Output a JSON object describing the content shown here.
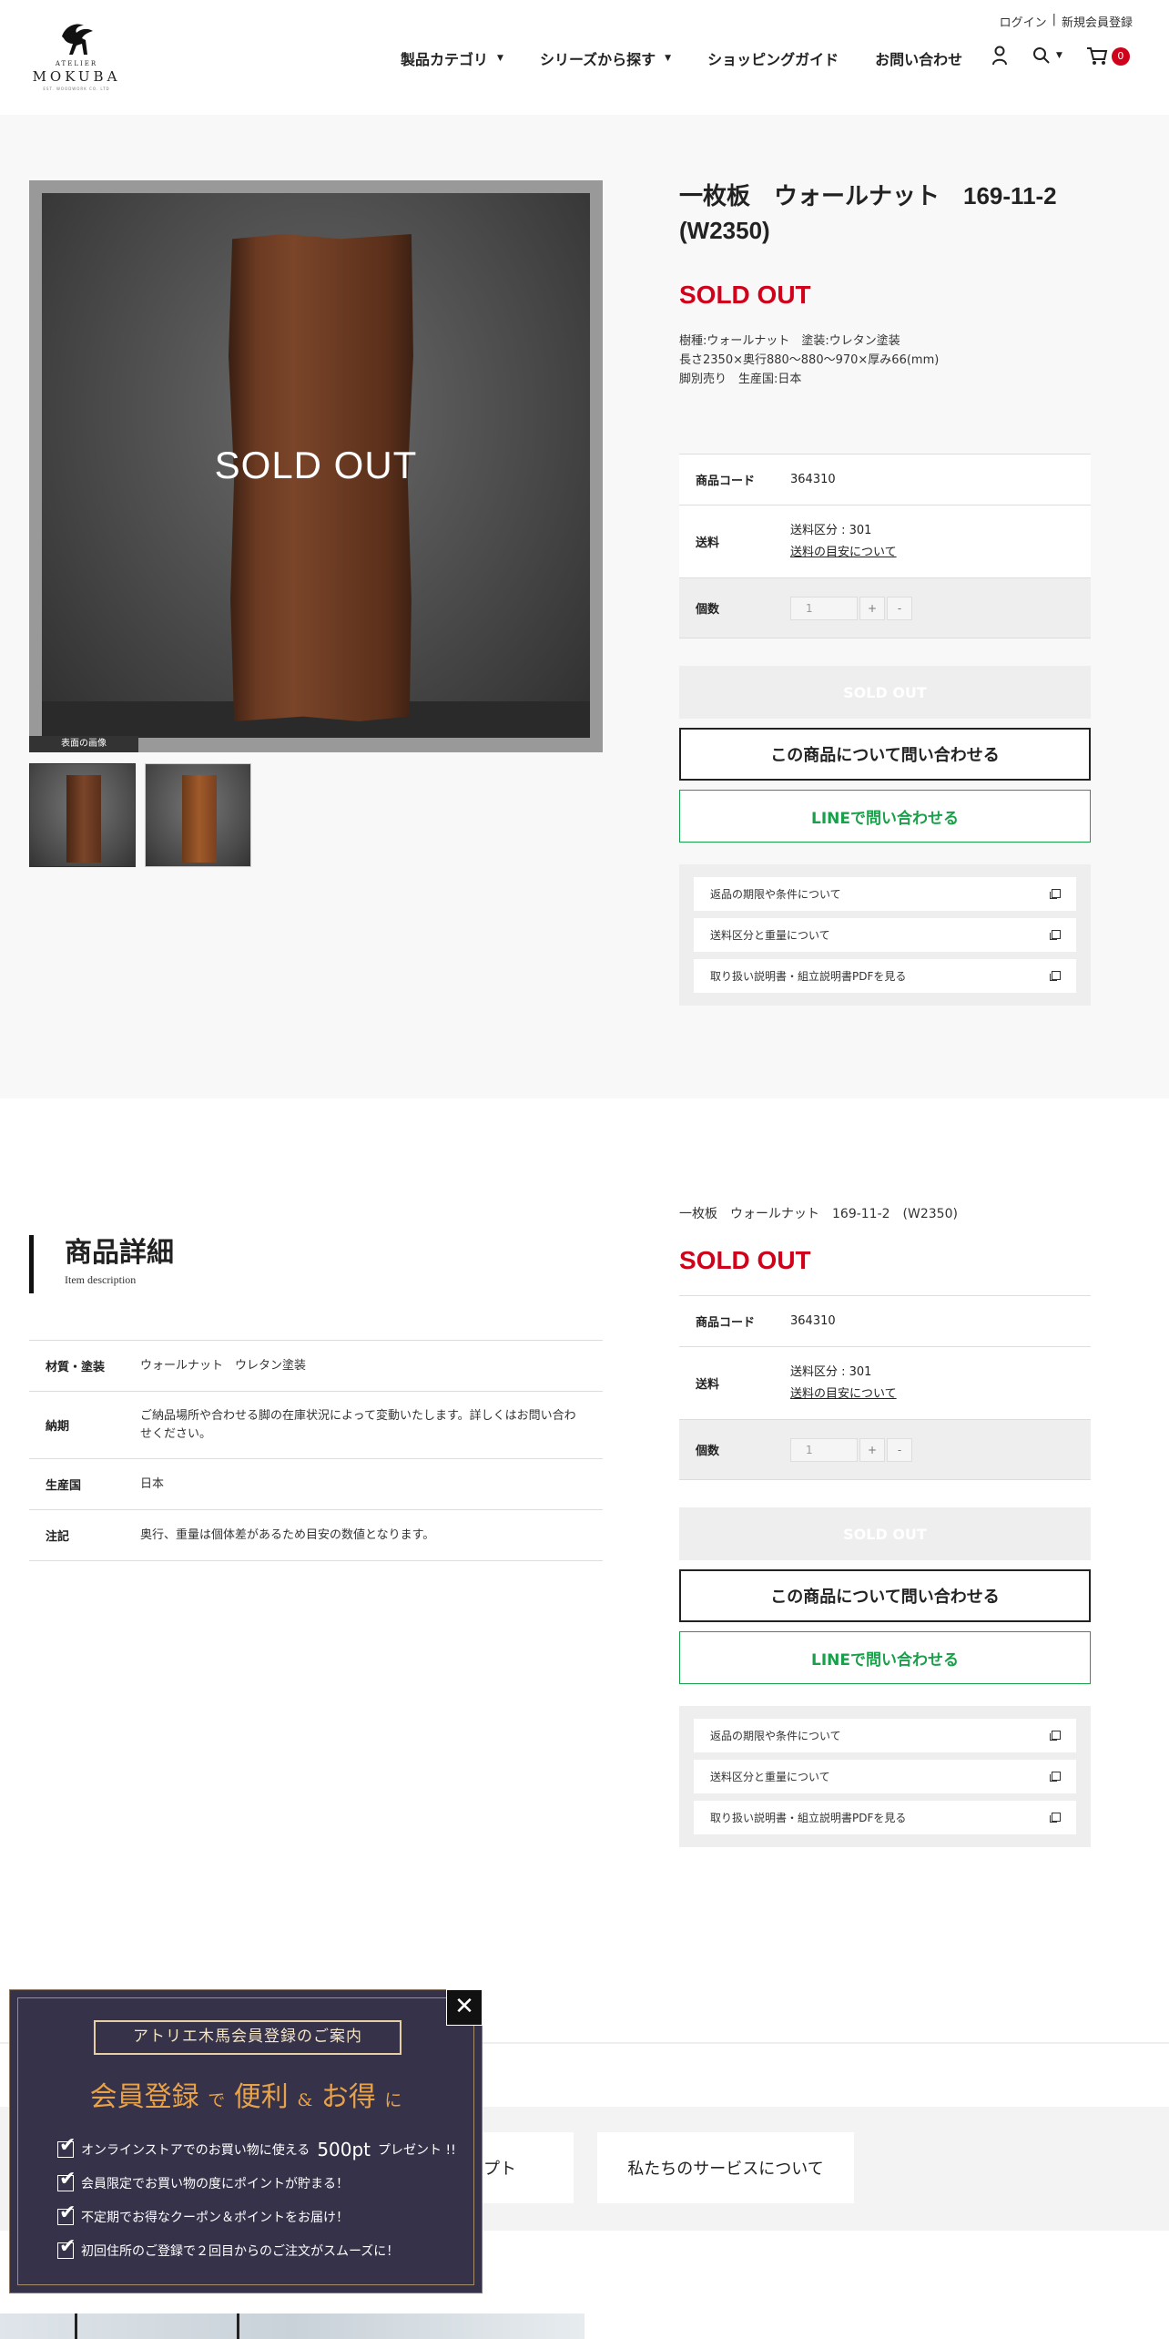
{
  "header": {
    "login": "ログイン",
    "separator": "|",
    "register": "新規会員登録",
    "logo": {
      "top": "ATELIER",
      "name": "MOKUBA",
      "since": "EST. WOODWORK CO. LTD"
    },
    "nav": [
      {
        "label": "製品カテゴリ",
        "has_caret": true
      },
      {
        "label": "シリーズから探す",
        "has_caret": true
      },
      {
        "label": "ショッピングガイド",
        "has_caret": false
      },
      {
        "label": "お問い合わせ",
        "has_caret": false
      }
    ],
    "cart_count": "0"
  },
  "gallery": {
    "sold_overlay": "SOLD OUT",
    "caption": "表面の画像"
  },
  "product": {
    "title": "一枚板　ウォールナット　169-11-2 (W2350)",
    "status": "SOLD OUT",
    "desc_line1": "樹種:ウォールナット　塗装:ウレタン塗装",
    "desc_line2": "長さ2350×奥行880～880～970×厚み66(mm)",
    "desc_line3": "脚別売り　生産国:日本",
    "code_label": "商品コード",
    "code_value": "364310",
    "shipping_label": "送料",
    "shipping_class": "送料区分 : 301",
    "shipping_link": "送料の目安について",
    "qty_label": "個数",
    "qty_value": "1",
    "qty_plus": "+",
    "qty_minus": "-",
    "sold_button": "SOLD OUT",
    "inquiry_button": "この商品について問い合わせる",
    "line_button": "LINEで問い合わせる",
    "links": [
      "返品の期限や条件について",
      "送料区分と重量について",
      "取り扱い説明書・組立説明書PDFを見る"
    ]
  },
  "detail": {
    "heading": "商品詳細",
    "subheading": "Item description",
    "rows": [
      {
        "key": "材質・塗装",
        "value": "ウォールナット　ウレタン塗装"
      },
      {
        "key": "納期",
        "value": "ご納品場所や合わせる脚の在庫状況によって変動いたします。詳しくはお問い合わせください。"
      },
      {
        "key": "生産国",
        "value": "日本"
      },
      {
        "key": "注記",
        "value": "奥行、重量は個体差があるため目安の数値となります。"
      }
    ],
    "side_title": "一枚板　ウォールナット　169-11-2　(W2350)"
  },
  "bottom": {
    "card1": "プト",
    "card2": "私たちのサービスについて"
  },
  "popup": {
    "close": "✕",
    "badge": "アトリエ木馬会員登録のご案内",
    "head_a": "会員登録",
    "head_b": "で",
    "head_c": "便利",
    "head_d": "&",
    "head_e": "お得",
    "head_f": "に",
    "item1_a": "オンラインストアでのお買い物に使える",
    "item1_b": "500pt",
    "item1_c": "プレゼント !!",
    "item2": "会員限定でお買い物の度にポイントが貯まる！",
    "item3": "不定期でお得なクーポン＆ポイントをお届け！",
    "item4": "初回住所のご登録で２回目からのご注文がスムーズに！"
  },
  "colors": {
    "accent_red": "#d0021b",
    "line_green": "#1aa04a",
    "popup_bg": "#35324a",
    "popup_gold": "#e8a24a"
  }
}
